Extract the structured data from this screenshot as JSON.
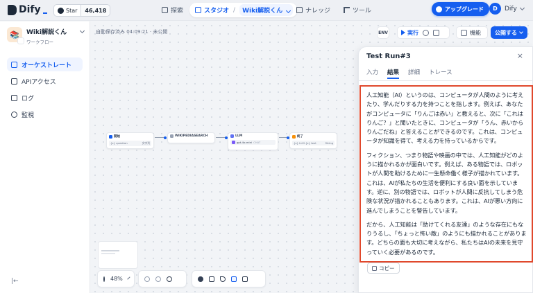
{
  "brand": {
    "name": "Dify",
    "github_label": "Star",
    "github_count": "46,418"
  },
  "nav": {
    "explore": "探索",
    "studio": "スタジオ",
    "studio_app": "Wiki解説くん",
    "knowledge": "ナレッジ",
    "tools": "ツール"
  },
  "header": {
    "upgrade_label": "アップグレード",
    "user_initial": "D",
    "user_name": "Dify"
  },
  "sidebar": {
    "app_name": "Wiki解説くん",
    "app_type": "ワークフロー",
    "items": [
      {
        "label": "オーケストレート",
        "active": true
      },
      {
        "label": "APIアクセス"
      },
      {
        "label": "ログ"
      },
      {
        "label": "監視"
      }
    ],
    "collapse_icon": "|←"
  },
  "canvas": {
    "autosave_text": "自動保存済み 04:09:21 · 未公開",
    "toolbar": {
      "env_label": "ENV",
      "run_label": "実行",
      "features_label": "機能",
      "publish_label": "公開する"
    },
    "nodes": {
      "start": {
        "title": "開始",
        "var_name": "{x} question",
        "var_type": "文字列"
      },
      "wiki": {
        "title": "WIKIPEDIASEARCH"
      },
      "llm": {
        "title": "LLM",
        "model": "gpt-4o-mini",
        "mode": "CHAT"
      },
      "end": {
        "title": "終了",
        "var_name": "{x} text",
        "var_source": "{x} LLM",
        "var_type": "String"
      }
    },
    "zoom_level": "48%"
  },
  "panel": {
    "title": "Test Run#3",
    "close_icon": "×",
    "tabs": [
      "入力",
      "結果",
      "詳細",
      "トレース"
    ],
    "active_tab": "結果",
    "result_paragraphs": [
      "人工知能（AI）というのは、コンピュータが人間のように考えたり、学んだりする力を持つことを指します。例えば、あなたがコンピュータに「りんごは赤い」と教えると、次に「これはりんご？」と聞いたときに、コンピュータが「うん、赤いからりんごだね」と答えることができるのです。これは、コンピュータが知識を得て、考える力を持っているからです。",
      "フィクション、つまり物語や映画の中では、人工知能がどのように描かれるかが面白いです。例えば、ある物語では、ロボットが人間を助けるために一生懸命働く様子が描かれています。これは、AIが私たちの生活を便利にする良い面を示しています。逆に、別の物語では、ロボットが人間に反抗してしまう危険な状況が描かれることもあります。これは、AIが悪い方向に進んでしまうことを警告しています。",
      "だから、人工知能は「助けてくれる友達」のような存在にもなりうるし、「ちょっと怖い敵」のようにも描かれることがあります。どちらの面も大切に考えながら、私たちはAIの未来を見守っていく必要があるのです。"
    ],
    "copy_label": "コピー"
  },
  "colors": {
    "accent": "#155eef",
    "highlight_border": "#e0482c"
  }
}
